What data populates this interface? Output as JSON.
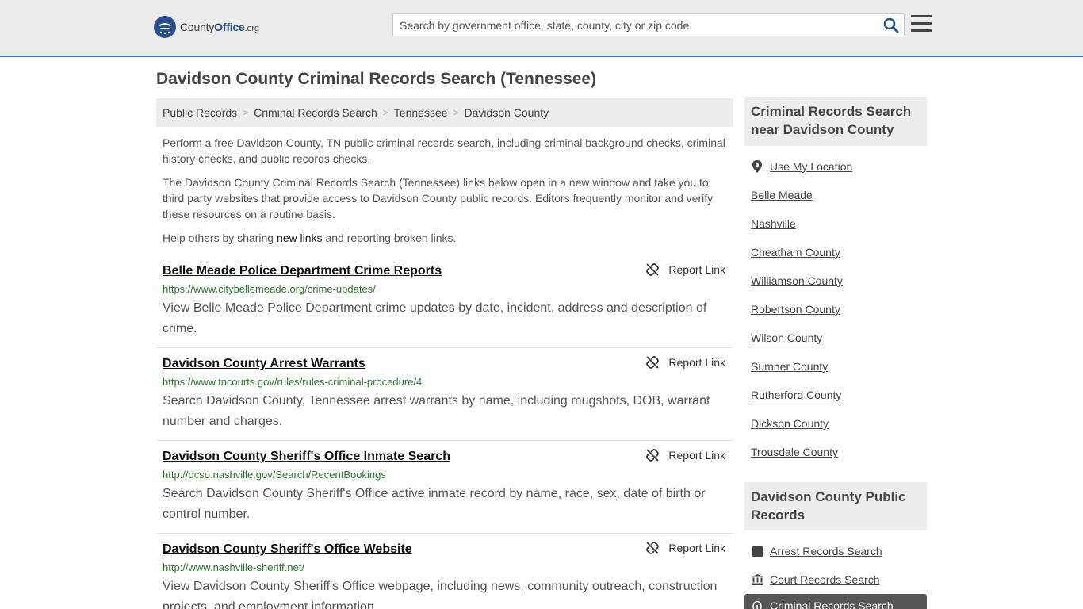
{
  "header": {
    "logo": {
      "part1": "County",
      "part2": "Office",
      "part3": ".org"
    },
    "search_placeholder": "Search by government office, state, county, city or zip code"
  },
  "page_title": "Davidson County Criminal Records Search (Tennessee)",
  "breadcrumb": [
    "Public Records",
    "Criminal Records Search",
    "Tennessee",
    "Davidson County"
  ],
  "intro": {
    "p1": "Perform a free Davidson County, TN public criminal records search, including criminal background checks, criminal history checks, and public records checks.",
    "p2": "The Davidson County Criminal Records Search (Tennessee) links below open in a new window and take you to third party websites that provide access to Davidson County public records. Editors frequently monitor and verify these resources on a routine basis.",
    "p3_before": "Help others by sharing ",
    "p3_link": "new links",
    "p3_after": " and reporting broken links."
  },
  "report_label": "Report Link",
  "results": [
    {
      "title": "Belle Meade Police Department Crime Reports",
      "url": "https://www.citybellemeade.org/crime-updates/",
      "desc": "View Belle Meade Police Department crime updates by date, incident, address and description of crime."
    },
    {
      "title": "Davidson County Arrest Warrants",
      "url": "https://www.tncourts.gov/rules/rules-criminal-procedure/4",
      "desc": "Search Davidson County, Tennessee arrest warrants by name, including mugshots, DOB, warrant number and charges."
    },
    {
      "title": "Davidson County Sheriff's Office Inmate Search",
      "url": "http://dcso.nashville.gov/Search/RecentBookings",
      "desc": "Search Davidson County Sheriff's Office active inmate record by name, race, sex, date of birth or control number."
    },
    {
      "title": "Davidson County Sheriff's Office Website",
      "url": "http://www.nashville-sheriff.net/",
      "desc": "View Davidson County Sheriff's Office webpage, including news, community outreach, construction projects, and employment information."
    }
  ],
  "sidebar": {
    "nearby_heading": "Criminal Records Search near Davidson County",
    "use_location": "Use My Location",
    "nearby": [
      "Belle Meade",
      "Nashville",
      "Cheatham County",
      "Williamson County",
      "Robertson County",
      "Wilson County",
      "Sumner County",
      "Rutherford County",
      "Dickson County",
      "Trousdale County"
    ],
    "public_heading": "Davidson County Public Records",
    "public_links": [
      {
        "label": "Arrest Records Search",
        "icon": "square-icon"
      },
      {
        "label": "Court Records Search",
        "icon": "courthouse-icon"
      }
    ],
    "active_link": {
      "label": "Criminal Records Search",
      "icon": "fingerprint-icon"
    }
  },
  "colors": {
    "accent": "#3f72b8",
    "url_green": "#2b7a2b",
    "logo_blue": "#27508f"
  }
}
